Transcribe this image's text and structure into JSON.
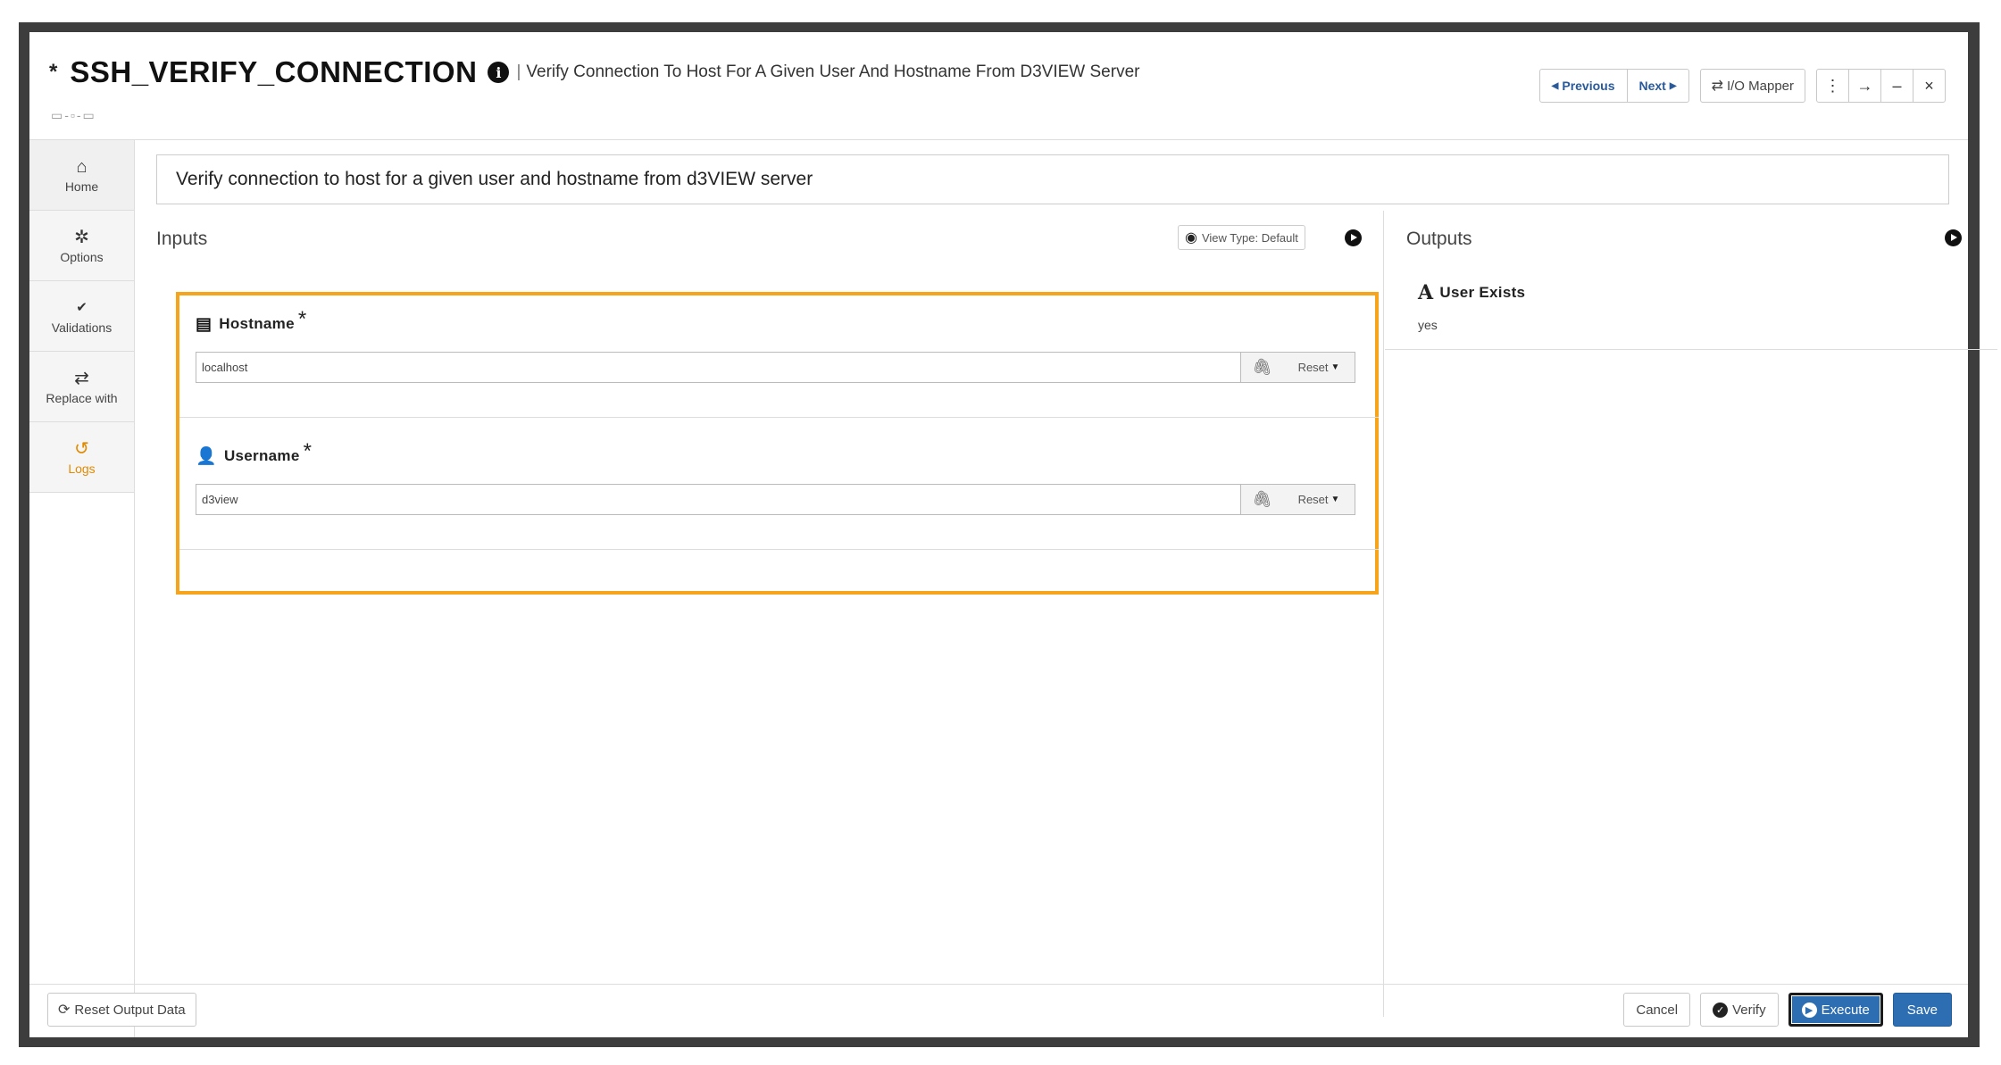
{
  "header": {
    "modified_marker": "*",
    "title": "SSH_VERIFY_CONNECTION",
    "separator": "|",
    "subtitle": "Verify Connection To Host For A Given User And Hostname From D3VIEW Server",
    "previous_label": "Previous",
    "next_label": "Next",
    "io_mapper_label": "I/O Mapper"
  },
  "sidebar": {
    "items": [
      {
        "label": "Home",
        "icon": "home-icon"
      },
      {
        "label": "Options",
        "icon": "gear-icon"
      },
      {
        "label": "Validations",
        "icon": "check-double-icon"
      },
      {
        "label": "Replace with",
        "icon": "swap-icon"
      },
      {
        "label": "Logs",
        "icon": "history-icon"
      }
    ]
  },
  "description": "Verify connection to host for a given user and hostname from d3VIEW server",
  "inputs": {
    "title": "Inputs",
    "view_type_label": "View Type: Default",
    "fields": [
      {
        "label": "Hostname",
        "required_marker": "*",
        "value": "localhost",
        "reset_label": "Reset",
        "icon": "server-icon"
      },
      {
        "label": "Username",
        "required_marker": "*",
        "value": "d3view",
        "reset_label": "Reset",
        "icon": "user-icon"
      }
    ]
  },
  "outputs": {
    "title": "Outputs",
    "items": [
      {
        "label": "User Exists",
        "value": "yes",
        "icon": "text-type-icon"
      }
    ]
  },
  "footer": {
    "reset_output_label": "Reset Output Data",
    "cancel_label": "Cancel",
    "verify_label": "Verify",
    "execute_label": "Execute",
    "save_label": "Save"
  },
  "colors": {
    "highlight": "#f5a41b",
    "primary": "#2d6eb3",
    "logs_accent": "#e08a00"
  }
}
